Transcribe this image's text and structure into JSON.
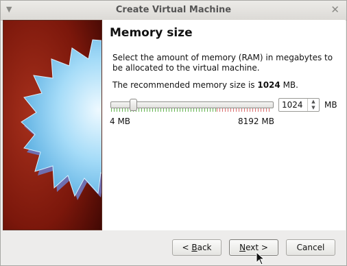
{
  "window": {
    "title": "Create Virtual Machine",
    "menu_icon": "chevron-down-icon",
    "close_icon": "close-icon"
  },
  "page": {
    "heading": "Memory size",
    "description": "Select the amount of memory (RAM) in megabytes to be allocated to the virtual machine.",
    "recommend_prefix": "The recommended memory size is ",
    "recommend_value": "1024",
    "recommend_suffix": " MB."
  },
  "memory": {
    "value": "1024",
    "unit": "MB",
    "min_label": "4 MB",
    "max_label": "8192 MB",
    "min_value": 4,
    "max_value": 8192,
    "slider_value": 1024
  },
  "buttons": {
    "back_prefix": "< ",
    "back_key": "B",
    "back_rest": "ack",
    "next_key": "N",
    "next_rest": "ext >",
    "cancel": "Cancel"
  },
  "colors": {
    "banner_red": "#8a1f10",
    "star_blue": "#7cc8f0",
    "tick_green": "#62b34e",
    "tick_red": "#d96b6b"
  }
}
